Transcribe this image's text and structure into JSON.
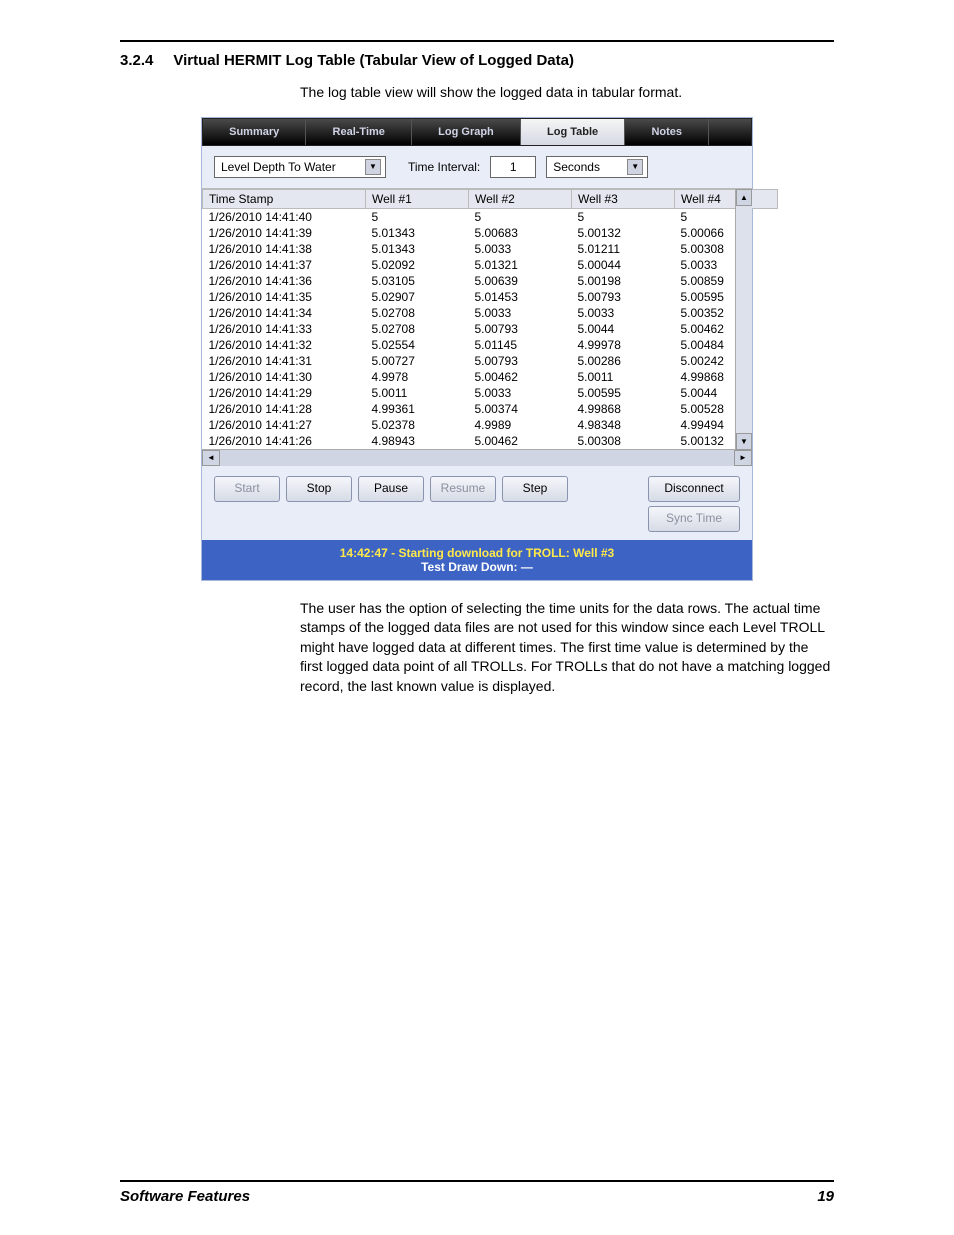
{
  "doc": {
    "section_num": "3.2.4",
    "section_title": "Virtual HERMIT Log Table (Tabular View of Logged Data)",
    "intro": "The log table view will show the logged data in tabular format.",
    "outro": "The user has the option of selecting the time units for the data rows. The actual time stamps of the logged data files are not used for this window since each Level TROLL might have logged data at different times. The first time value is determined by the first logged data point of all TROLLs. For TROLLs that do not have a matching logged record, the last known value is displayed.",
    "footer_left": "Software Features",
    "footer_right": "19"
  },
  "tabs": [
    {
      "label": "Summary",
      "active": false
    },
    {
      "label": "Real-Time",
      "active": false
    },
    {
      "label": "Log Graph",
      "active": false
    },
    {
      "label": "Log Table",
      "active": true
    },
    {
      "label": "Notes",
      "active": false
    }
  ],
  "controls": {
    "parameter": "Level Depth To Water",
    "interval_label": "Time Interval:",
    "interval_value": "1",
    "interval_units": "Seconds"
  },
  "table": {
    "headers": [
      "Time Stamp",
      "Well #1",
      "Well #2",
      "Well #3",
      "Well #4"
    ],
    "rows": [
      [
        "1/26/2010 14:41:40",
        "5",
        "5",
        "5",
        "5"
      ],
      [
        "1/26/2010 14:41:39",
        "5.01343",
        "5.00683",
        "5.00132",
        "5.00066"
      ],
      [
        "1/26/2010 14:41:38",
        "5.01343",
        "5.0033",
        "5.01211",
        "5.00308"
      ],
      [
        "1/26/2010 14:41:37",
        "5.02092",
        "5.01321",
        "5.00044",
        "5.0033"
      ],
      [
        "1/26/2010 14:41:36",
        "5.03105",
        "5.00639",
        "5.00198",
        "5.00859"
      ],
      [
        "1/26/2010 14:41:35",
        "5.02907",
        "5.01453",
        "5.00793",
        "5.00595"
      ],
      [
        "1/26/2010 14:41:34",
        "5.02708",
        "5.0033",
        "5.0033",
        "5.00352"
      ],
      [
        "1/26/2010 14:41:33",
        "5.02708",
        "5.00793",
        "5.0044",
        "5.00462"
      ],
      [
        "1/26/2010 14:41:32",
        "5.02554",
        "5.01145",
        "4.99978",
        "5.00484"
      ],
      [
        "1/26/2010 14:41:31",
        "5.00727",
        "5.00793",
        "5.00286",
        "5.00242"
      ],
      [
        "1/26/2010 14:41:30",
        "4.9978",
        "5.00462",
        "5.0011",
        "4.99868"
      ],
      [
        "1/26/2010 14:41:29",
        "5.0011",
        "5.0033",
        "5.00595",
        "5.0044"
      ],
      [
        "1/26/2010 14:41:28",
        "4.99361",
        "5.00374",
        "4.99868",
        "5.00528"
      ],
      [
        "1/26/2010 14:41:27",
        "5.02378",
        "4.9989",
        "4.98348",
        "4.99494"
      ],
      [
        "1/26/2010 14:41:26",
        "4.98943",
        "5.00462",
        "5.00308",
        "5.00132"
      ]
    ]
  },
  "buttons": {
    "start": "Start",
    "stop": "Stop",
    "pause": "Pause",
    "resume": "Resume",
    "step": "Step",
    "disconnect": "Disconnect",
    "sync": "Sync Time"
  },
  "status": {
    "line1": "14:42:47 - Starting download for TROLL: Well #3",
    "line2": "Test Draw Down: —"
  }
}
